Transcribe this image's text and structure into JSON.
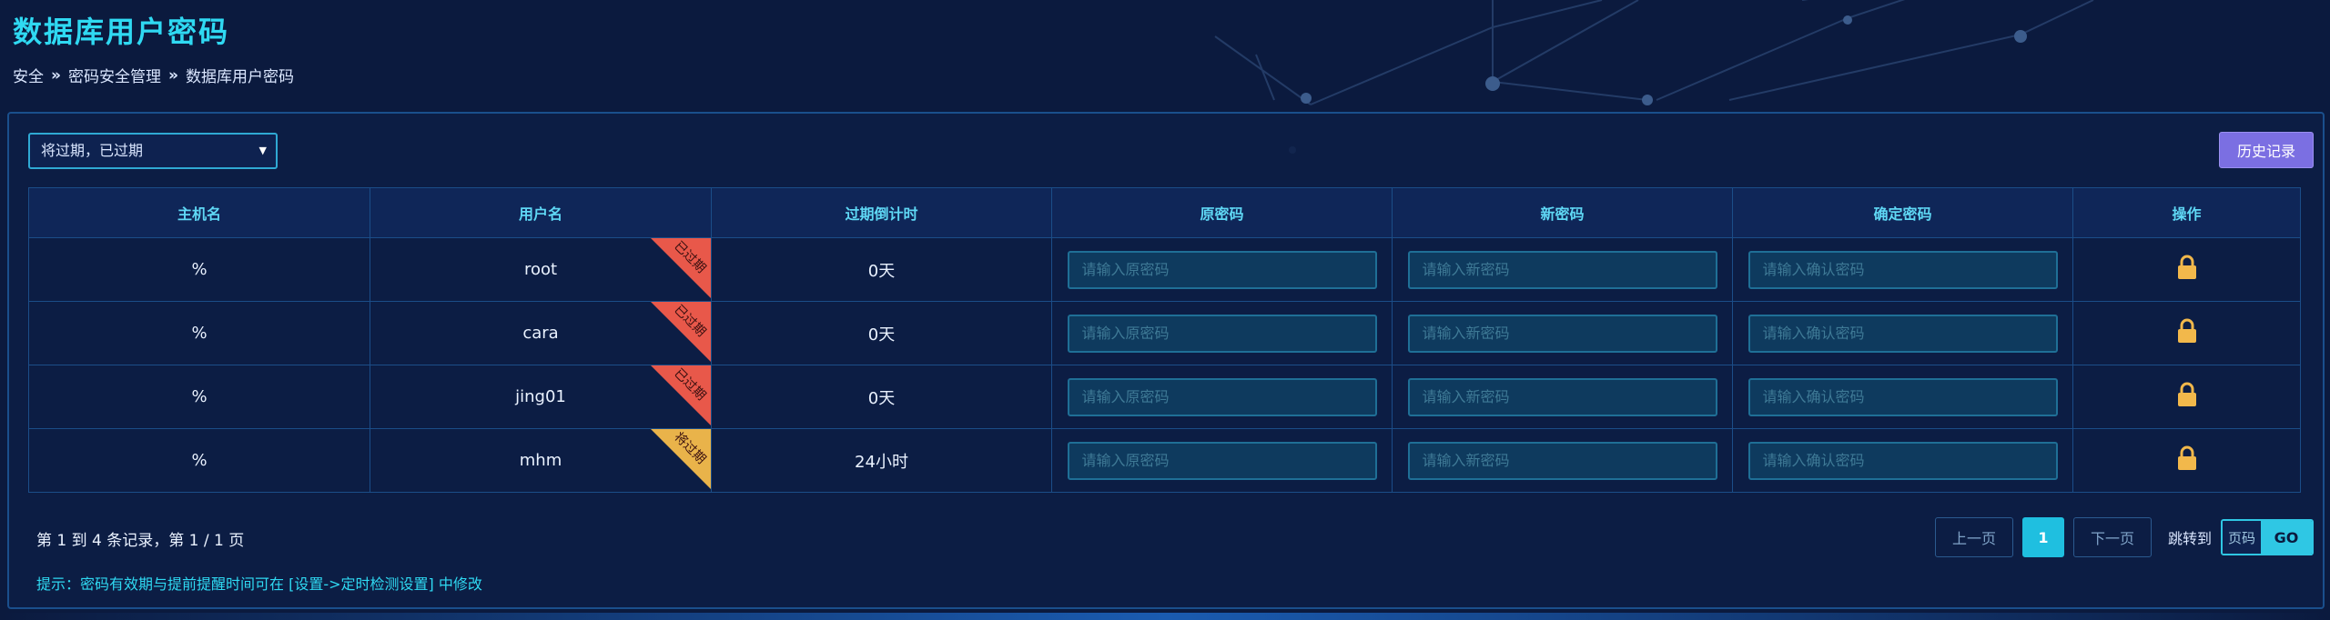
{
  "page": {
    "title": "数据库用户密码",
    "breadcrumb": [
      "安全",
      "密码安全管理",
      "数据库用户密码"
    ],
    "breadcrumb_sep": "»"
  },
  "toolbar": {
    "filter_value": "将过期，已过期",
    "history_label": "历史记录"
  },
  "table": {
    "headers": [
      "主机名",
      "用户名",
      "过期倒计时",
      "原密码",
      "新密码",
      "确定密码",
      "操作"
    ],
    "rows": [
      {
        "host": "%",
        "user": "root",
        "status": "已过期",
        "countdown": "0天"
      },
      {
        "host": "%",
        "user": "cara",
        "status": "已过期",
        "countdown": "0天"
      },
      {
        "host": "%",
        "user": "jing01",
        "status": "已过期",
        "countdown": "0天"
      },
      {
        "host": "%",
        "user": "mhm",
        "status": "将过期",
        "countdown": "24小时"
      }
    ],
    "placeholders": {
      "old": "请输入原密码",
      "new": "请输入新密码",
      "confirm": "请输入确认密码"
    }
  },
  "colors": {
    "expired": "#e8584a",
    "expiring": "#e9b34a",
    "lock": "#f2b84b",
    "accent": "#2fd9f2"
  },
  "footer": {
    "page_info": "第 1 到 4 条记录，第 1 / 1 页",
    "hint": "提示：密码有效期与提前提醒时间可在 [设置->定时检测设置] 中修改",
    "prev": "上一页",
    "current_page": "1",
    "next": "下一页",
    "jump_label": "跳转到",
    "jump_placeholder": "页码",
    "go": "GO"
  }
}
